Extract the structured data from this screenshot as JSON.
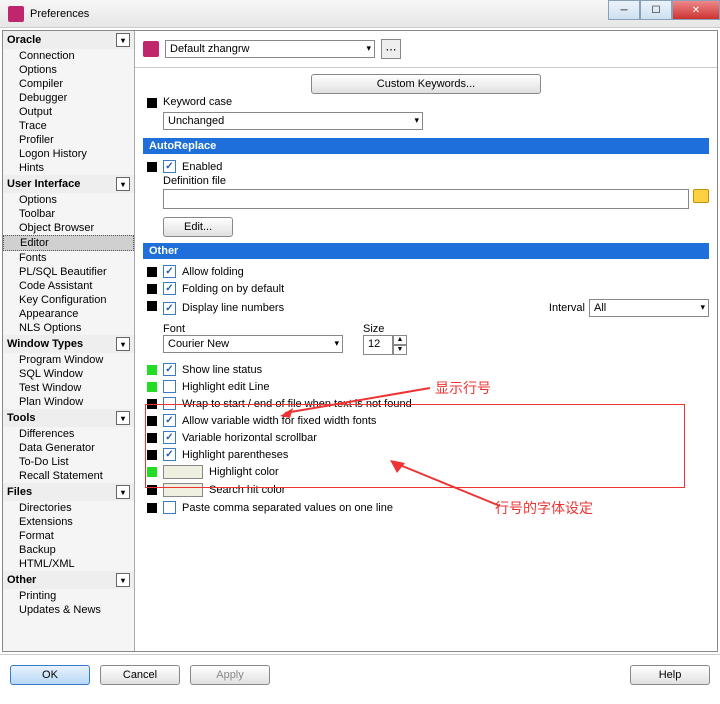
{
  "window": {
    "title": "Preferences"
  },
  "profile": {
    "label": "Default zhangrw"
  },
  "sidebar": {
    "oracle": {
      "title": "Oracle",
      "items": [
        "Connection",
        "Options",
        "Compiler",
        "Debugger",
        "Output",
        "Trace",
        "Profiler",
        "Logon History",
        "Hints"
      ]
    },
    "ui": {
      "title": "User Interface",
      "items": [
        "Options",
        "Toolbar",
        "Object Browser",
        "Editor",
        "Fonts",
        "PL/SQL Beautifier",
        "Code Assistant",
        "Key Configuration",
        "Appearance",
        "NLS Options"
      ]
    },
    "wt": {
      "title": "Window Types",
      "items": [
        "Program Window",
        "SQL Window",
        "Test Window",
        "Plan Window"
      ]
    },
    "tools": {
      "title": "Tools",
      "items": [
        "Differences",
        "Data Generator",
        "To-Do List",
        "Recall Statement"
      ]
    },
    "files": {
      "title": "Files",
      "items": [
        "Directories",
        "Extensions",
        "Format",
        "Backup",
        "HTML/XML"
      ]
    },
    "other": {
      "title": "Other",
      "items": [
        "Printing",
        "Updates & News"
      ]
    }
  },
  "buttons": {
    "custom_keywords": "Custom Keywords...",
    "edit": "Edit...",
    "ok": "OK",
    "cancel": "Cancel",
    "apply": "Apply",
    "help": "Help"
  },
  "labels": {
    "keyword_case": "Keyword case",
    "keyword_case_value": "Unchanged",
    "autoreplace": "AutoReplace",
    "enabled": "Enabled",
    "definition_file": "Definition file",
    "other": "Other",
    "allow_folding": "Allow folding",
    "folding_default": "Folding on by default",
    "display_line_numbers": "Display line numbers",
    "interval": "Interval",
    "interval_value": "All",
    "font": "Font",
    "font_value": "Courier New",
    "size": "Size",
    "size_value": "12",
    "show_line_status": "Show line status",
    "highlight_edit": "Highlight edit Line",
    "wrap_text": "Wrap to start / end of file when text is not found",
    "allow_var_width": "Allow variable width for fixed width fonts",
    "var_scroll": "Variable horizontal scrollbar",
    "highlight_paren": "Highlight parentheses",
    "highlight_color": "Highlight color",
    "search_hit": "Search hit color",
    "paste_comma": "Paste comma separated values on one line"
  },
  "annotations": {
    "show_line_numbers": "显示行号",
    "font_setting": "行号的字体设定"
  }
}
